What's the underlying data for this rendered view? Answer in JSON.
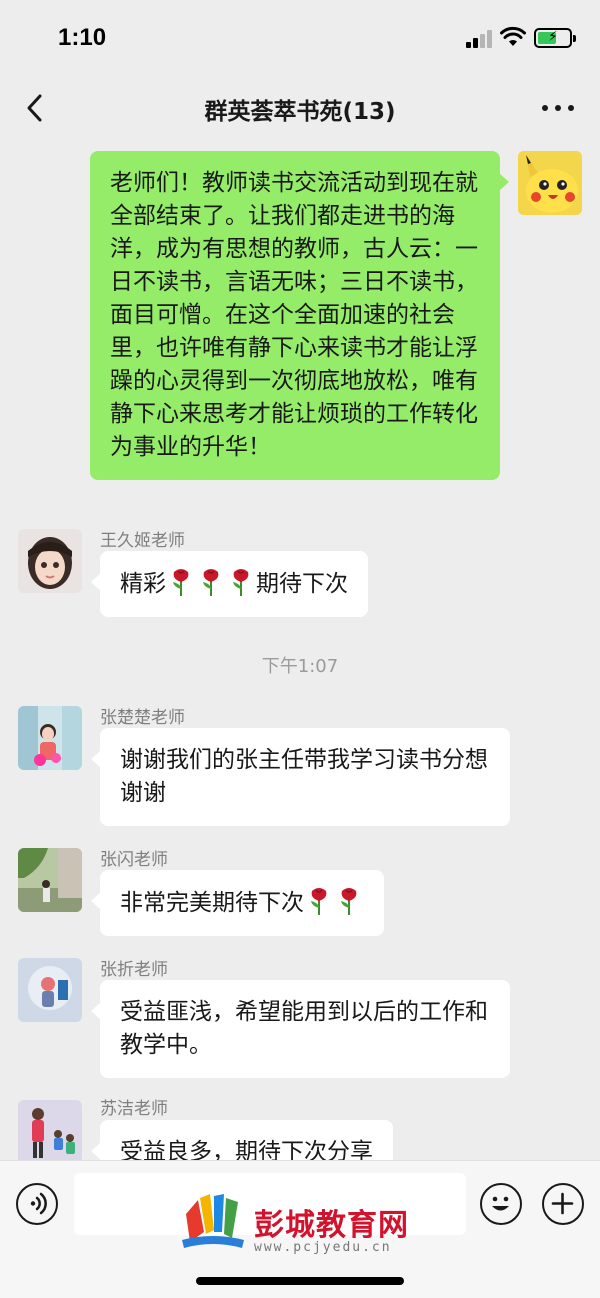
{
  "status_bar": {
    "time": "1:10"
  },
  "header": {
    "title": "群英荟萃书苑(13)"
  },
  "messages": [
    {
      "sender": "",
      "direction": "out",
      "text": "老师们！教师读书交流活动到现在就全部结束了。让我们都走进书的海洋，成为有思想的教师，古人云：一日不读书，言语无味；三日不读书，面目可憎。在这个全面加速的社会里，也许唯有静下心来读书才能让浮躁的心灵得到一次彻底地放松，唯有静下心来思考才能让烦琐的工作转化为事业的升华！"
    },
    {
      "sender": "王久姬老师",
      "direction": "in",
      "text_before": "精彩",
      "text_after": "期待下次",
      "emoji": "rose",
      "emoji_count": 3
    },
    {
      "sender": "张楚楚老师",
      "direction": "in",
      "text": "谢谢我们的张主任带我学习读书分想谢谢"
    },
    {
      "sender": "张闪老师",
      "direction": "in",
      "text_before": "非常完美期待下次",
      "emoji": "rose",
      "emoji_count": 2
    },
    {
      "sender": "张折老师",
      "direction": "in",
      "text": "受益匪浅，希望能用到以后的工作和教学中。"
    },
    {
      "sender": "苏洁老师",
      "direction": "in",
      "text": "受益良多，期待下次分享"
    }
  ],
  "timestamp": "下午1:07",
  "icons": {
    "back": "chevron-left-icon",
    "more": "more-dots-icon",
    "voice": "voice-icon",
    "emoji": "emoji-icon",
    "plus": "plus-icon"
  },
  "colors": {
    "bubble_out": "#95ec69",
    "bubble_in": "#ffffff",
    "background": "#ededed",
    "watermark_red": "#d3132d"
  },
  "watermark": {
    "name": "彭城教育网",
    "url": "www.pcjyedu.cn"
  }
}
